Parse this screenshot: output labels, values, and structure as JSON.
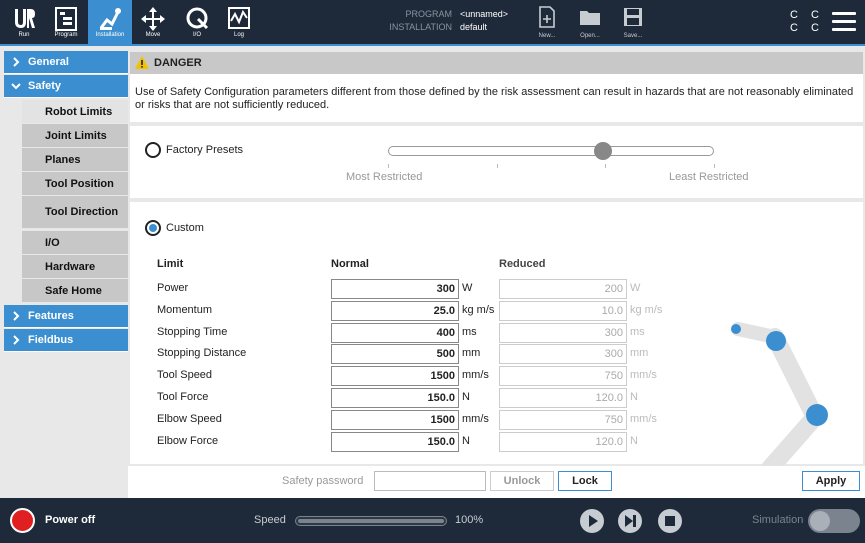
{
  "topbar": {
    "nav": [
      {
        "label": "Run",
        "icon": "ur-logo-icon"
      },
      {
        "label": "Program",
        "icon": "program-icon"
      },
      {
        "label": "Installation",
        "icon": "installation-icon"
      },
      {
        "label": "Move",
        "icon": "move-icon"
      },
      {
        "label": "I/O",
        "icon": "io-icon"
      },
      {
        "label": "Log",
        "icon": "log-icon"
      }
    ],
    "program_key": "PROGRAM",
    "program_value": "<unnamed>",
    "installation_key": "INSTALLATION",
    "installation_value": "default",
    "file_buttons": [
      {
        "label": "New...",
        "icon": "new-file-icon"
      },
      {
        "label": "Open...",
        "icon": "open-folder-icon"
      },
      {
        "label": "Save...",
        "icon": "save-icon"
      }
    ],
    "cc_row1": "C C",
    "cc_row2": "C C"
  },
  "sidebar": {
    "general": "General",
    "safety": "Safety",
    "subitems": [
      "Robot Limits",
      "Joint Limits",
      "Planes",
      "Tool Position",
      "Tool Direction",
      "I/O",
      "Hardware",
      "Safe Home"
    ],
    "features": "Features",
    "fieldbus": "Fieldbus"
  },
  "danger": {
    "title": "DANGER",
    "text": "Use of Safety Configuration parameters different from those defined by the risk assessment can result in hazards that are not reasonably eliminated or risks that are not sufficiently reduced."
  },
  "presets": {
    "label": "Factory Presets",
    "min_label": "Most Restricted",
    "max_label": "Least Restricted",
    "level": 0.66
  },
  "custom": {
    "label": "Custom",
    "col_limit": "Limit",
    "col_normal": "Normal",
    "col_reduced": "Reduced",
    "rows": [
      {
        "name": "Power",
        "normal": "300",
        "reduced": "200",
        "unit": "W"
      },
      {
        "name": "Momentum",
        "normal": "25.0",
        "reduced": "10.0",
        "unit": "kg m/s"
      },
      {
        "name": "Stopping Time",
        "normal": "400",
        "reduced": "300",
        "unit": "ms"
      },
      {
        "name": "Stopping Distance",
        "normal": "500",
        "reduced": "300",
        "unit": "mm"
      },
      {
        "name": "Tool Speed",
        "normal": "1500",
        "reduced": "750",
        "unit": "mm/s"
      },
      {
        "name": "Tool Force",
        "normal": "150.0",
        "reduced": "120.0",
        "unit": "N"
      },
      {
        "name": "Elbow Speed",
        "normal": "1500",
        "reduced": "750",
        "unit": "mm/s"
      },
      {
        "name": "Elbow Force",
        "normal": "150.0",
        "reduced": "120.0",
        "unit": "N"
      }
    ]
  },
  "password": {
    "label": "Safety password",
    "value": "",
    "unlock": "Unlock",
    "lock": "Lock",
    "apply": "Apply"
  },
  "bottom": {
    "power": "Power off",
    "speed_label": "Speed",
    "speed_value": "100%",
    "speed_fraction": 1.0,
    "simulation": "Simulation"
  },
  "colors": {
    "accent": "#3b8fd0",
    "topbar": "#1e2a3a",
    "power": "#e02020"
  }
}
